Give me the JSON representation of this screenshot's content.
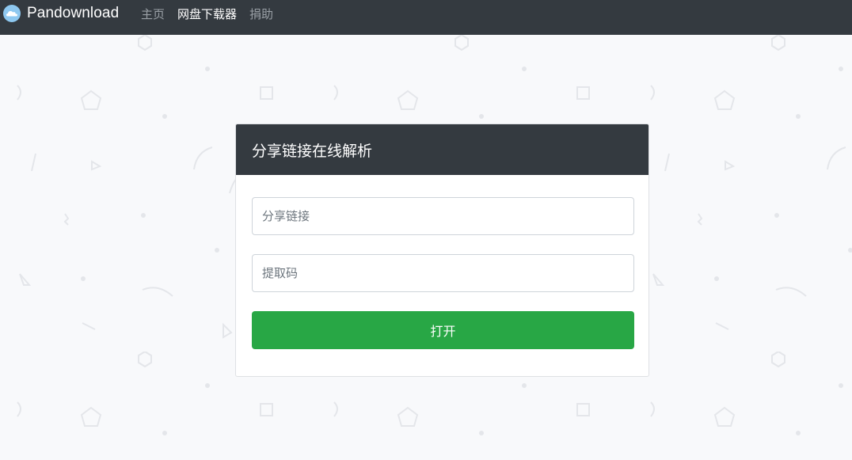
{
  "navbar": {
    "brand": "Pandownload",
    "links": [
      {
        "label": "主页",
        "active": false
      },
      {
        "label": "网盘下载器",
        "active": true
      },
      {
        "label": "捐助",
        "active": false
      }
    ]
  },
  "form": {
    "title": "分享链接在线解析",
    "link_input": {
      "value": "",
      "placeholder": "分享链接"
    },
    "code_input": {
      "value": "",
      "placeholder": "提取码"
    },
    "submit_label": "打开"
  },
  "colors": {
    "navbar_bg": "#343a40",
    "page_bg": "#f8f9fb",
    "button_green": "#28a745",
    "brand_icon": "#8ec8f0"
  },
  "icons": {
    "brand": "cloud-icon"
  }
}
